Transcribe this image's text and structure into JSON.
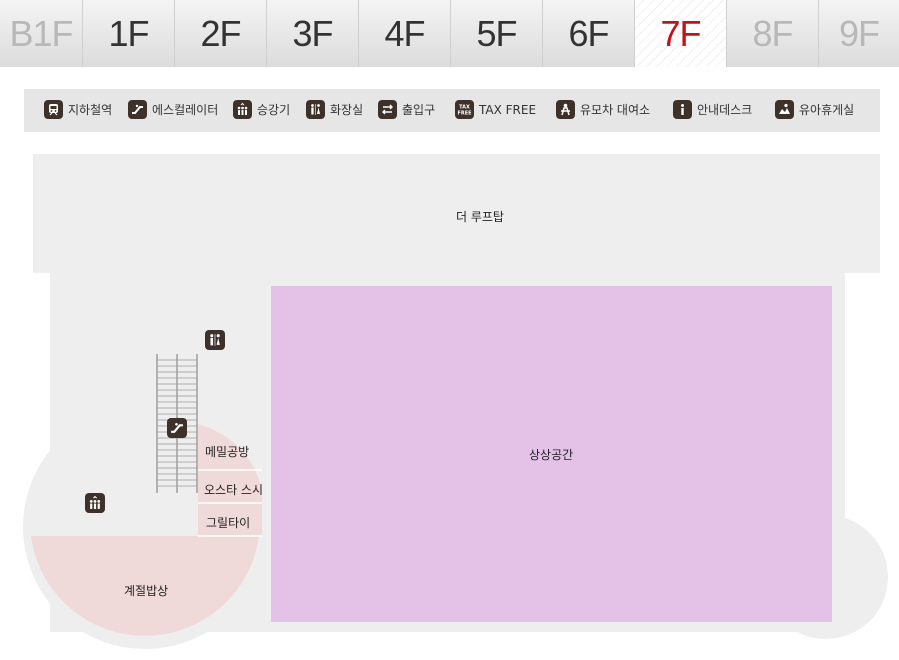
{
  "floors": [
    {
      "label": "B1F",
      "state": "disabled"
    },
    {
      "label": "1F",
      "state": "normal"
    },
    {
      "label": "2F",
      "state": "normal"
    },
    {
      "label": "3F",
      "state": "normal"
    },
    {
      "label": "4F",
      "state": "normal"
    },
    {
      "label": "5F",
      "state": "normal"
    },
    {
      "label": "6F",
      "state": "normal"
    },
    {
      "label": "7F",
      "state": "active"
    },
    {
      "label": "8F",
      "state": "disabled"
    },
    {
      "label": "9F",
      "state": "disabled"
    }
  ],
  "legend": [
    {
      "icon": "subway-icon",
      "label": "지하철역"
    },
    {
      "icon": "escalator-icon",
      "label": "에스컬레이터"
    },
    {
      "icon": "elevator-icon",
      "label": "승강기"
    },
    {
      "icon": "restroom-icon",
      "label": "화장실"
    },
    {
      "icon": "entrance-icon",
      "label": "출입구"
    },
    {
      "icon": "tax-free-icon",
      "label": "TAX FREE"
    },
    {
      "icon": "stroller-icon",
      "label": "유모차 대여소"
    },
    {
      "icon": "info-icon",
      "label": "안내데스크"
    },
    {
      "icon": "nursing-room-icon",
      "label": "유아휴게실"
    }
  ],
  "map": {
    "rooftop": "더 루프탑",
    "imagination_space": "상상공간",
    "stores": [
      "메밀공방",
      "오스타 스시",
      "그릴타이"
    ],
    "seasonal_table": "계절밥상"
  },
  "colors": {
    "active_floor": "#c0141b",
    "icon_bg": "#3d3129",
    "floor_area": "#eeeeee",
    "restaurant_area": "#f0d9d9",
    "event_area": "#e4c2e8"
  }
}
